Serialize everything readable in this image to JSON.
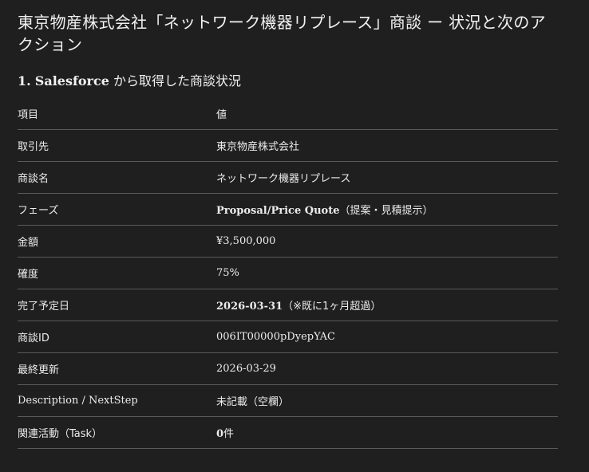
{
  "page": {
    "title": "東京物産株式会社「ネットワーク機器リプレース」商談 ー 状況と次のアクション"
  },
  "section": {
    "number": "1.",
    "brand": "Salesforce",
    "heading_rest": " から取得した商談状況"
  },
  "table": {
    "headers": {
      "key": "項目",
      "value": "値"
    },
    "rows": [
      {
        "key": "取引先",
        "value_bold": "",
        "value": "東京物産株式会社"
      },
      {
        "key": "商談名",
        "value_bold": "",
        "value": "ネットワーク機器リプレース"
      },
      {
        "key": "フェーズ",
        "value_bold": "Proposal/Price Quote",
        "value": "（提案・見積提示）"
      },
      {
        "key": "金額",
        "value_bold": "",
        "value": "¥3,500,000"
      },
      {
        "key": "確度",
        "value_bold": "",
        "value": "75%"
      },
      {
        "key": "完了予定日",
        "value_bold": "2026-03-31",
        "value": "（※既に1ヶ月超過）"
      },
      {
        "key": "商談ID",
        "value_bold": "",
        "value": "006IT00000pDyepYAC"
      },
      {
        "key": "最終更新",
        "value_bold": "",
        "value": "2026-03-29"
      },
      {
        "key": "Description / NextStep",
        "value_bold": "",
        "value": "未記載（空欄）"
      },
      {
        "key": "関連活動（Task）",
        "value_bold": "0",
        "value": "件"
      }
    ]
  }
}
